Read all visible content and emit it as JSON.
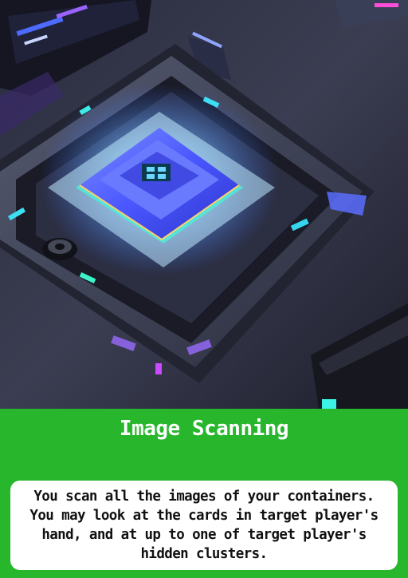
{
  "card": {
    "title": "Image Scanning",
    "rules_text": "You scan all the images of your containers. You may look at the cards in target player's hand, and at up to one of target player's hidden clusters.",
    "colors": {
      "frame": "#28b62c",
      "title_text": "#ffffff",
      "text_box": "#ffffff",
      "rules_text": "#111111"
    }
  },
  "artwork": {
    "subject": "glowing-holographic-chip-scanner"
  }
}
